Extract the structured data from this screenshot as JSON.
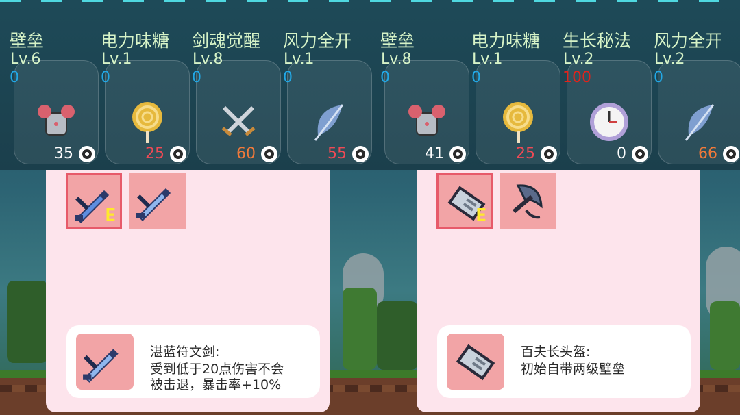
{
  "skills": [
    {
      "name": "壁垒",
      "level": "Lv.6",
      "count": "0",
      "cost": "35",
      "icon": "armor-icon"
    },
    {
      "name": "电力味糖",
      "level": "Lv.1",
      "count": "0",
      "cost": "25",
      "icon": "lollipop-icon"
    },
    {
      "name": "剑魂觉醒",
      "level": "Lv.8",
      "count": "0",
      "cost": "60",
      "icon": "crossed-swords-icon"
    },
    {
      "name": "风力全开",
      "level": "Lv.1",
      "count": "0",
      "cost": "55",
      "icon": "feather-icon"
    },
    {
      "name": "壁垒",
      "level": "Lv.8",
      "count": "0",
      "cost": "41",
      "icon": "armor-icon"
    },
    {
      "name": "电力味糖",
      "level": "Lv.1",
      "count": "0",
      "cost": "25",
      "icon": "lollipop-icon"
    },
    {
      "name": "生长秘法",
      "level": "Lv.2",
      "count": "100",
      "cost": "0",
      "icon": "clock-icon"
    },
    {
      "name": "风力全开",
      "level": "Lv.2",
      "count": "0",
      "cost": "66",
      "icon": "feather-icon"
    }
  ],
  "colors": {
    "cost_white": "#ffffff",
    "cost_red": "#f04a55",
    "cost_orange": "#f27a3a",
    "count_blue": "#22a8e6",
    "count_red": "#e0231c",
    "panel_bg": "#fde4ec",
    "slot_bg": "#f2a4a6"
  },
  "left_panel": {
    "slots": [
      {
        "icon": "blue-rune-sword-icon",
        "badge": "E"
      },
      {
        "icon": "blue-rune-sword-icon",
        "badge": ""
      }
    ],
    "desc_title": "湛蓝符文剑:",
    "desc_lines": [
      "受到低于20点伤害不会",
      "被击退，暴击率+10%"
    ]
  },
  "right_panel": {
    "slots": [
      {
        "icon": "helmet-icon",
        "badge": "E"
      },
      {
        "icon": "axe-icon",
        "badge": ""
      }
    ],
    "desc_title": "百夫长头盔:",
    "desc_lines": [
      "初始自带两级壁垒"
    ]
  }
}
